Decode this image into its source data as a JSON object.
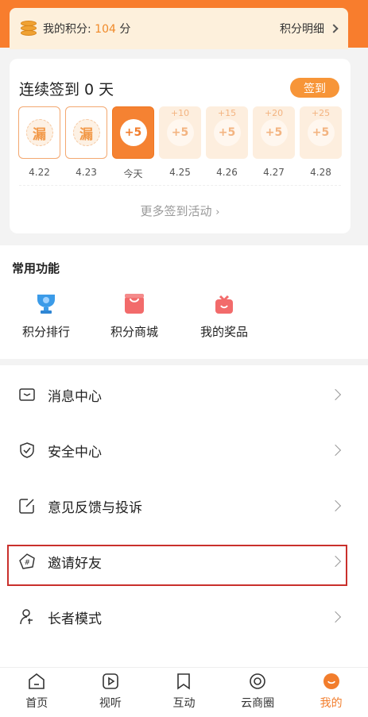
{
  "points": {
    "label": "我的积分: ",
    "value": "104",
    "unit": "分",
    "detail_label": "积分明细"
  },
  "checkin": {
    "title": "连续签到 0 天",
    "button_label": "签到",
    "days": [
      {
        "status": "missed",
        "mark": "漏",
        "bonus": "",
        "date": "4.22"
      },
      {
        "status": "missed",
        "mark": "漏",
        "bonus": "",
        "date": "4.23"
      },
      {
        "status": "today",
        "mark": "+5",
        "bonus": "",
        "date": "今天"
      },
      {
        "status": "future",
        "mark": "+5",
        "bonus": "+10",
        "date": "4.25"
      },
      {
        "status": "future",
        "mark": "+5",
        "bonus": "+15",
        "date": "4.26"
      },
      {
        "status": "future",
        "mark": "+5",
        "bonus": "+20",
        "date": "4.27"
      },
      {
        "status": "future",
        "mark": "+5",
        "bonus": "+25",
        "date": "4.28"
      }
    ],
    "more_label": "更多签到活动"
  },
  "common": {
    "title": "常用功能",
    "items": [
      {
        "label": "积分排行",
        "icon": "trophy-icon"
      },
      {
        "label": "积分商城",
        "icon": "shopping-bag-icon"
      },
      {
        "label": "我的奖品",
        "icon": "gift-icon"
      }
    ]
  },
  "menu": {
    "items": [
      {
        "label": "消息中心",
        "icon": "message-icon"
      },
      {
        "label": "安全中心",
        "icon": "shield-icon"
      },
      {
        "label": "意见反馈与投诉",
        "icon": "feedback-edit-icon"
      },
      {
        "label": "邀请好友",
        "icon": "invite-hash-icon"
      },
      {
        "label": "长者模式",
        "icon": "elder-mode-icon"
      }
    ]
  },
  "nav": {
    "items": [
      {
        "label": "首页",
        "icon": "home-icon"
      },
      {
        "label": "视听",
        "icon": "play-icon"
      },
      {
        "label": "互动",
        "icon": "bookmark-icon"
      },
      {
        "label": "云商圈",
        "icon": "cloud-circle-icon"
      },
      {
        "label": "我的",
        "icon": "profile-icon"
      }
    ],
    "active": "我的"
  },
  "colors": {
    "accent": "#f27d2c",
    "header": "#f87d2d",
    "highlight": "#c9302c"
  }
}
